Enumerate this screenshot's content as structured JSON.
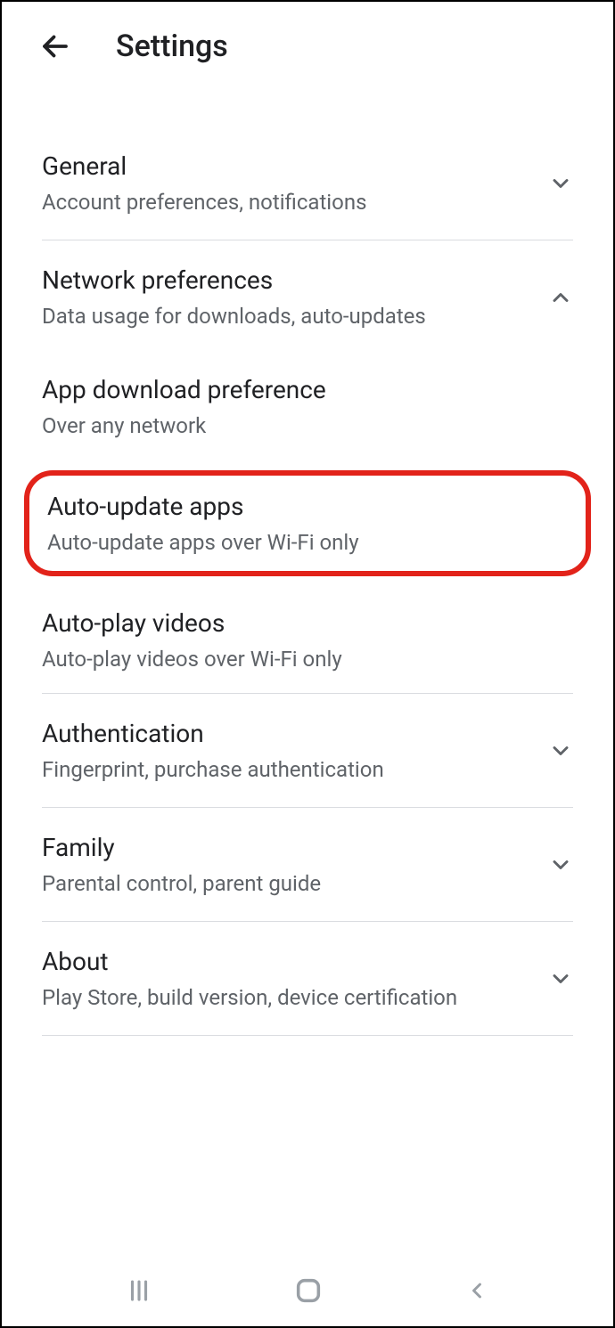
{
  "header": {
    "title": "Settings"
  },
  "sections": {
    "general": {
      "title": "General",
      "subtitle": "Account preferences, notifications"
    },
    "network": {
      "title": "Network preferences",
      "subtitle": "Data usage for downloads, auto-updates"
    },
    "app_download": {
      "title": "App download preference",
      "subtitle": "Over any network"
    },
    "auto_update": {
      "title": "Auto-update apps",
      "subtitle": "Auto-update apps over Wi-Fi only"
    },
    "auto_play": {
      "title": "Auto-play videos",
      "subtitle": "Auto-play videos over Wi-Fi only"
    },
    "authentication": {
      "title": "Authentication",
      "subtitle": "Fingerprint, purchase authentication"
    },
    "family": {
      "title": "Family",
      "subtitle": "Parental control, parent guide"
    },
    "about": {
      "title": "About",
      "subtitle": "Play Store, build version, device certification"
    }
  }
}
